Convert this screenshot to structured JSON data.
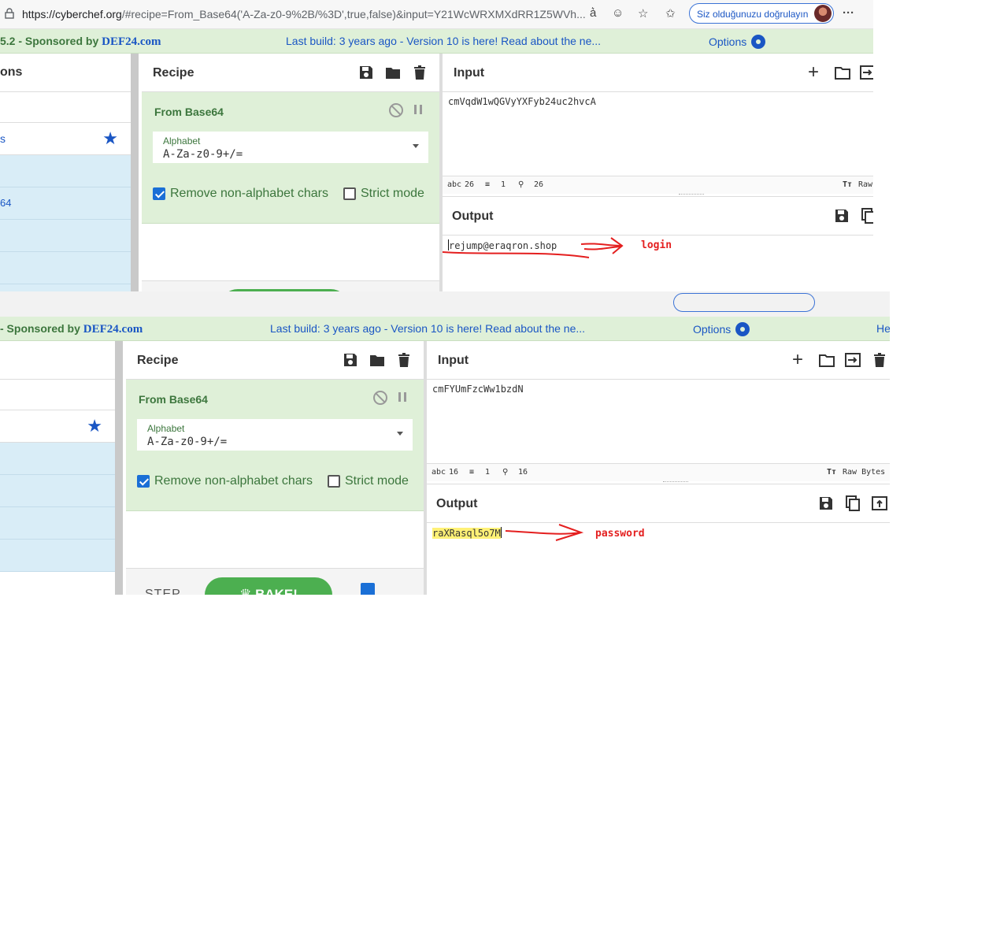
{
  "browser": {
    "url_host": "https://cyberchef.org",
    "url_rest": "/#recipe=From_Base64('A-Za-z0-9%2B/%3D',true,false)&input=Y21WcWRXMXdRR1Z5WVh...",
    "verify_label": "Siz olduğunuzu doğrulayın",
    "more_label": "···"
  },
  "banner": {
    "version_1": "5.2 - Sponsored by ",
    "version_2": " - Sponsored by ",
    "sponsor": "DEF24.com",
    "build": "Last build: 3 years ago - Version 10 is here! Read about the ne...",
    "options": "Options",
    "help": "He"
  },
  "operations": {
    "title_fragment": "ons",
    "fav_fragment": "s",
    "item_fragment": "64"
  },
  "recipe": {
    "title": "Recipe",
    "op_title": "From Base64",
    "alphabet_label": "Alphabet",
    "alphabet_value": "A-Za-z0-9+/=",
    "remove_label": "Remove non-alphabet chars",
    "strict_label": "Strict mode",
    "step_label": "STEP",
    "bake_label": "BAKE!"
  },
  "shot1": {
    "input_title": "Input",
    "input_value": "cmVqdW1wQGVyYXFyb24uc2hvcA",
    "stat_chars": "26",
    "stat_lines": "1",
    "stat_pos": "26",
    "raw_label": "Raw",
    "output_title": "Output",
    "output_value": "rejump@eraqron.shop",
    "annotation": "login"
  },
  "shot2": {
    "input_title": "Input",
    "input_value": "cmFYUmFzcWw1bzdN",
    "stat_chars": "16",
    "stat_lines": "1",
    "stat_pos": "16",
    "raw_label": "Raw Bytes",
    "output_title": "Output",
    "output_value": "raXRasql5o7M",
    "annotation": "password"
  },
  "colors": {
    "accent_blue": "#1a56c4",
    "banner_green": "#dff0d8",
    "text_green": "#3c763d",
    "annotation_red": "#e41f1f",
    "highlight_yellow": "#fff176"
  }
}
